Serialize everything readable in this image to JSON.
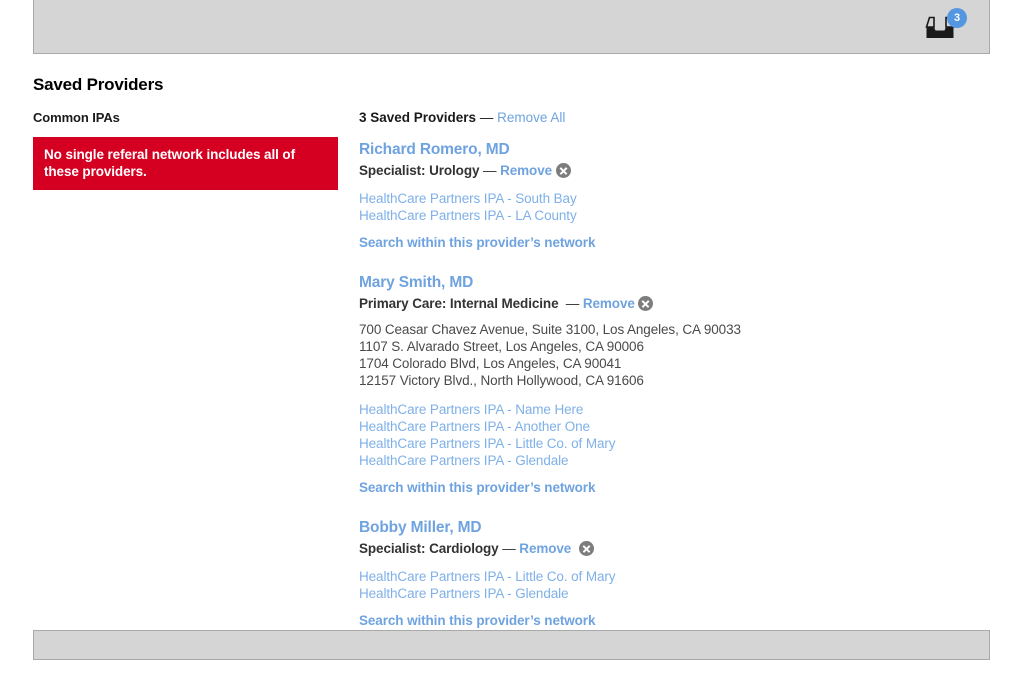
{
  "top_panel": {
    "inbox_icon": "inbox-tray-icon",
    "badge_count": "3"
  },
  "section": {
    "title": "Saved Providers"
  },
  "sidebar": {
    "heading": "Common IPAs",
    "alert_text": "No single referal network includes all of these providers."
  },
  "list": {
    "count_label": "3 Saved Providers",
    "dash": "—",
    "remove_all_label": "Remove All"
  },
  "labels": {
    "remove": "Remove",
    "dash": "—",
    "search_network": "Search within this provider’s network"
  },
  "providers": [
    {
      "name": "Richard Romero, MD",
      "specialty": "Specialist: Urology",
      "specialty_spacer": " ",
      "addresses": [],
      "ipas": [
        "HealthCare Partners IPA - South Bay",
        "HealthCare Partners IPA - LA County"
      ]
    },
    {
      "name": "Mary Smith, MD",
      "specialty": "Primary Care: Internal Medicine",
      "specialty_spacer": "  ",
      "addresses": [
        "700 Ceasar Chavez Avenue, Suite 3100, Los Angeles, CA 90033",
        "1107 S. Alvarado Street, Los Angeles, CA 90006",
        "1704 Colorado Blvd, Los Angeles, CA 90041",
        "12157 Victory Blvd., North Hollywood, CA 91606"
      ],
      "ipas": [
        "HealthCare Partners IPA - Name Here",
        "HealthCare Partners IPA - Another One",
        "HealthCare Partners IPA - Little Co. of Mary",
        "HealthCare Partners IPA - Glendale"
      ]
    },
    {
      "name": "Bobby Miller, MD",
      "specialty": "Specialist: Cardiology",
      "specialty_spacer": " ",
      "addresses": [],
      "ipas": [
        "HealthCare Partners IPA - Little Co. of Mary",
        "HealthCare Partners IPA - Glendale"
      ]
    }
  ],
  "colors": {
    "link_blue": "#6fa3e0",
    "alert_red": "#d50021",
    "panel_gray": "#d5d5d5",
    "badge_blue": "#5596e0",
    "x_button_gray": "#7d7d7d"
  }
}
